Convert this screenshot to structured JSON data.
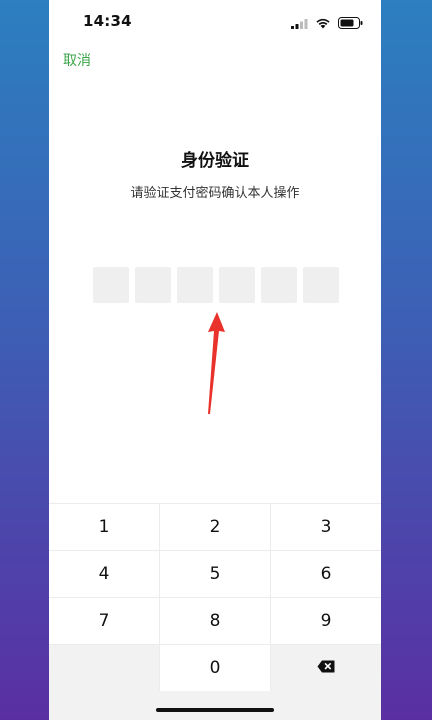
{
  "status_bar": {
    "time": "14:34",
    "icons": [
      "signal-icon",
      "wifi-icon",
      "battery-icon"
    ]
  },
  "header": {
    "cancel_label": "取消"
  },
  "verify": {
    "title": "身份验证",
    "subtitle": "请验证支付密码确认本人操作",
    "pin_length": 6
  },
  "annotation": {
    "arrow_color": "#e8322b"
  },
  "keypad": {
    "rows": [
      [
        "1",
        "2",
        "3"
      ],
      [
        "4",
        "5",
        "6"
      ],
      [
        "7",
        "8",
        "9"
      ],
      [
        "",
        "0",
        "delete-icon"
      ]
    ]
  },
  "colors": {
    "accent": "#3aa54a"
  }
}
